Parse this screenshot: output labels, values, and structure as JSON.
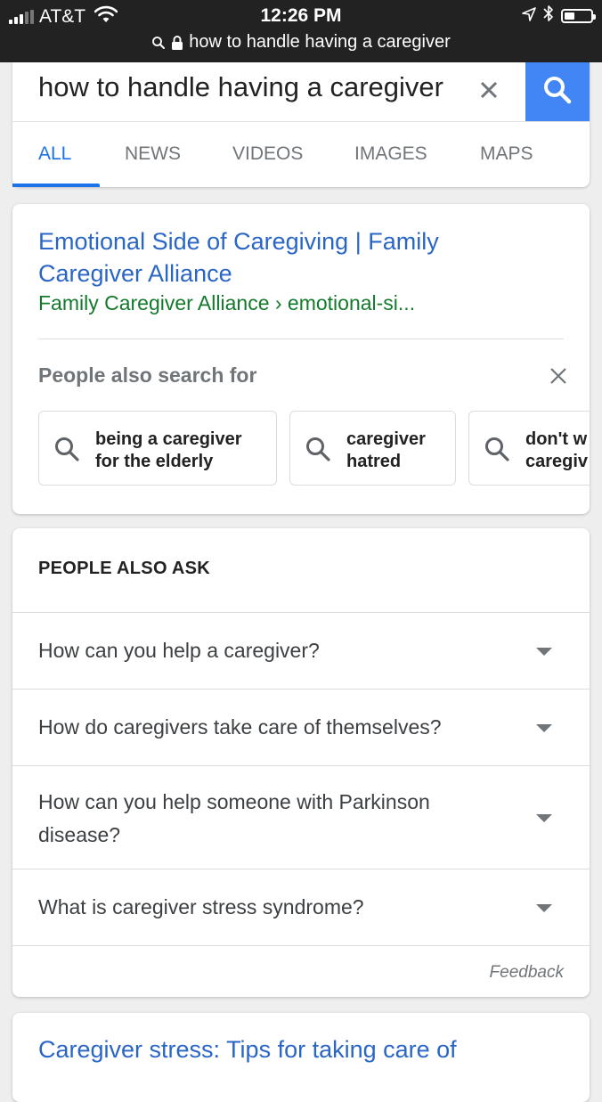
{
  "status_bar": {
    "carrier": "AT&T",
    "time": "12:26 PM",
    "url": "how to handle having a caregiver",
    "battery_level": 0.4,
    "icons": [
      "signal-icon",
      "wifi-icon",
      "location-icon",
      "bluetooth-icon",
      "battery-icon",
      "search-icon",
      "lock-icon"
    ]
  },
  "search": {
    "query": "how to handle having a caregiver",
    "clear_icon": "close-icon",
    "search_button_icon": "search-icon",
    "accent_color": "#4285f4"
  },
  "tabs": [
    {
      "label": "ALL",
      "active": true
    },
    {
      "label": "NEWS",
      "active": false
    },
    {
      "label": "VIDEOS",
      "active": false
    },
    {
      "label": "IMAGES",
      "active": false
    },
    {
      "label": "MAPS",
      "active": false
    }
  ],
  "result": {
    "title": "Emotional Side of Caregiving | Family Caregiver Alliance",
    "source": "Family Caregiver Alliance › emotional-si...",
    "link_color": "#2a66c6",
    "source_color": "#137a2c"
  },
  "people_also_search": {
    "title": "People also search for",
    "close_icon": "close-icon",
    "chips": [
      {
        "label": "being a caregiver\nfor the elderly"
      },
      {
        "label": "caregiver\nhatred"
      },
      {
        "label": "don't w\ncaregiv"
      }
    ]
  },
  "people_also_ask": {
    "header": "PEOPLE ALSO ASK",
    "questions": [
      "How can you help a caregiver?",
      "How do caregivers take care of themselves?",
      "How can you help someone with Parkinson disease?",
      "What is caregiver stress syndrome?"
    ],
    "feedback": "Feedback"
  },
  "next_result": {
    "title": "Caregiver stress: Tips for taking care of"
  }
}
